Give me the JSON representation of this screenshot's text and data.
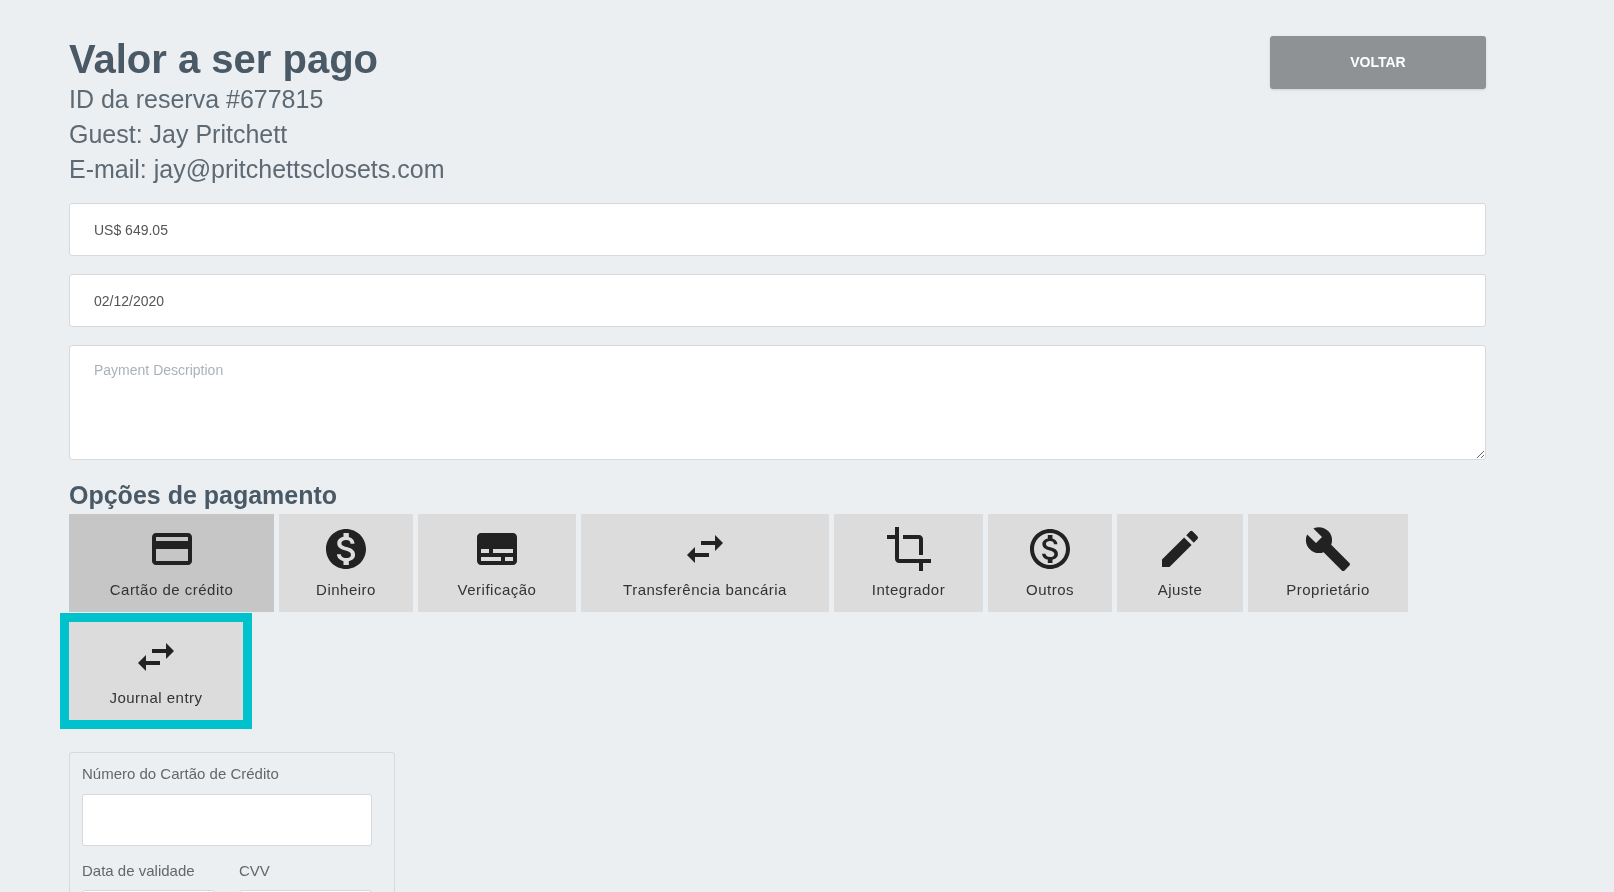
{
  "header": {
    "title": "Valor a ser pago",
    "reservation": "ID da reserva #677815",
    "guest": "Guest: Jay Pritchett",
    "email": "E-mail: jay@pritchettsclosets.com"
  },
  "back_button": "VOLTAR",
  "amount_field": {
    "value": "US$ 649.05"
  },
  "date_field": {
    "value": "02/12/2020"
  },
  "description_field": {
    "placeholder": "Payment Description"
  },
  "payment_options": {
    "title": "Opções de pagamento",
    "options": [
      {
        "label": "Cartão de crédito",
        "selected": true,
        "highlighted": false
      },
      {
        "label": "Dinheiro",
        "selected": false,
        "highlighted": false
      },
      {
        "label": "Verificação",
        "selected": false,
        "highlighted": false
      },
      {
        "label": "Transferência bancária",
        "selected": false,
        "highlighted": false
      },
      {
        "label": "Integrador",
        "selected": false,
        "highlighted": false
      },
      {
        "label": "Outros",
        "selected": false,
        "highlighted": false
      },
      {
        "label": "Ajuste",
        "selected": false,
        "highlighted": false
      },
      {
        "label": "Proprietário",
        "selected": false,
        "highlighted": false
      },
      {
        "label": "Journal entry",
        "selected": false,
        "highlighted": true
      }
    ]
  },
  "card_form": {
    "card_number_label": "Número do Cartão de Crédito",
    "expiry_label": "Data de validade",
    "cvv_label": "CVV"
  }
}
